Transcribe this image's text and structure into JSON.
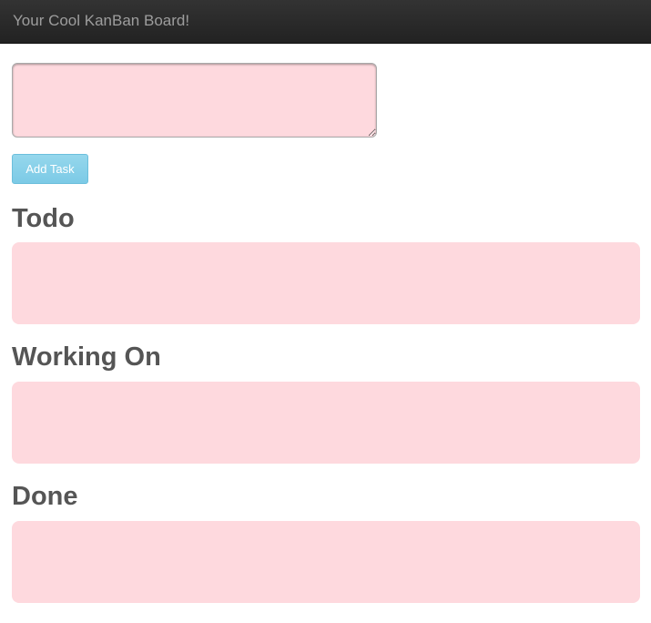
{
  "navbar": {
    "brand": "Your Cool KanBan Board!"
  },
  "task_form": {
    "input_value": "",
    "add_button_label": "Add Task"
  },
  "columns": [
    {
      "title": "Todo"
    },
    {
      "title": "Working On"
    },
    {
      "title": "Done"
    }
  ],
  "colors": {
    "navbar": "#2b2b2b",
    "brand_text": "#9d9d9d",
    "pink_fill": "#fed9de",
    "button": "#87cfe8",
    "heading_text": "#555555"
  }
}
